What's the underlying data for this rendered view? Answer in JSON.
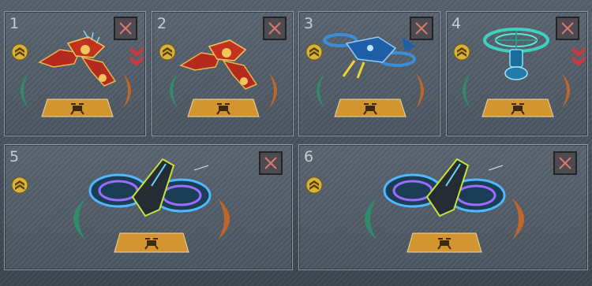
{
  "slots": [
    {
      "number": "1",
      "craft": "red-gold-fighter-craft",
      "has_chevrons": true
    },
    {
      "number": "2",
      "craft": "red-gold-fighter-craft",
      "has_chevrons": false
    },
    {
      "number": "3",
      "craft": "blue-hover-gunship-craft",
      "has_chevrons": false
    },
    {
      "number": "4",
      "craft": "teal-rotor-drone-craft",
      "has_chevrons": true
    },
    {
      "number": "5",
      "craft": "twin-disc-hover-craft",
      "has_chevrons": false
    },
    {
      "number": "6",
      "craft": "twin-disc-hover-craft",
      "has_chevrons": false
    }
  ],
  "colors": {
    "arc_left": "#2f8c6b",
    "arc_right": "#c0662b",
    "pad_orange": "#d2952f",
    "chevron_red": "#c93a3a",
    "close_x": "#d9786e",
    "rank_gold": "#d9b23a"
  },
  "icons": {
    "rank": "rank-chevron-icon",
    "close": "close-icon",
    "pad": "drone-pad-icon"
  }
}
